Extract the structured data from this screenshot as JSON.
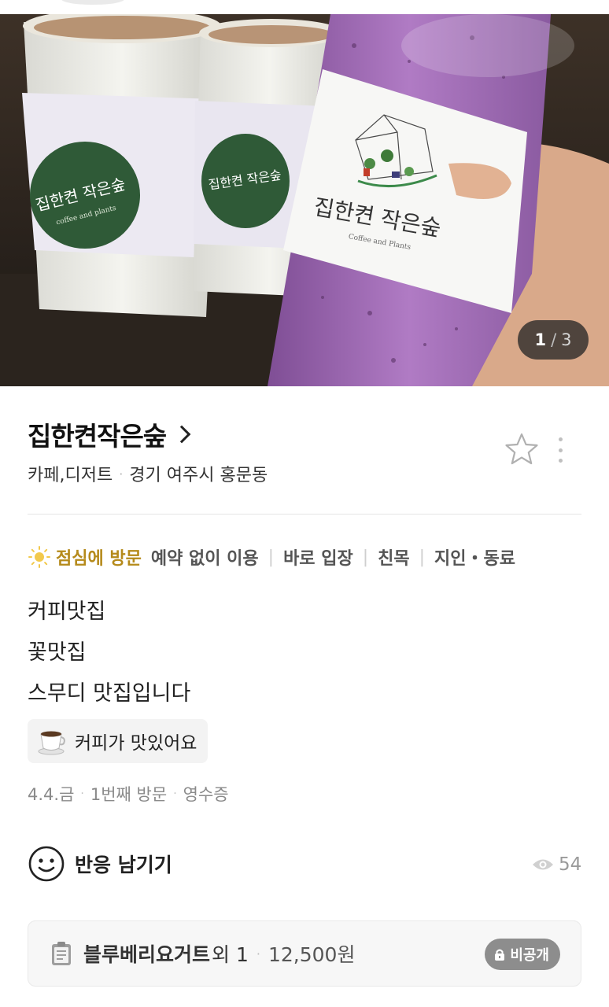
{
  "photo": {
    "counter_current": "1",
    "counter_separator": "/",
    "counter_total": "3",
    "sleeve_text_green": "집한켠 작은숲",
    "sleeve_sub_green": "coffee and plants",
    "sleeve_text_white": "집한켠 작은숲",
    "sleeve_sub_white": "Coffee and Plants"
  },
  "place": {
    "title": "집한켠작은숲",
    "category": "카페,디저트",
    "address": "경기 여주시 홍문동"
  },
  "tags": {
    "visit_time": "점심에 방문",
    "items": [
      "예약 없이 이용",
      "바로 입장",
      "친목",
      "지인・동료"
    ]
  },
  "review": {
    "lines": [
      "커피맛집",
      "꽃맛집",
      "스무디 맛집입니다"
    ]
  },
  "keyword_chip": {
    "icon": "coffee-cup-icon",
    "label": "커피가 맛있어요"
  },
  "meta": {
    "date": "4.4.금",
    "visit_count": "1번째 방문",
    "proof": "영수증"
  },
  "reaction": {
    "label": "반응 남기기",
    "views": "54"
  },
  "order": {
    "item": "블루베리요거트",
    "extra": "외 1",
    "price": "12,500원",
    "privacy": "비공개"
  },
  "colors": {
    "accent_visit": "#b58a1b",
    "sleeve_green": "#2f5a37",
    "smoothie_purple": "#a471b8"
  }
}
